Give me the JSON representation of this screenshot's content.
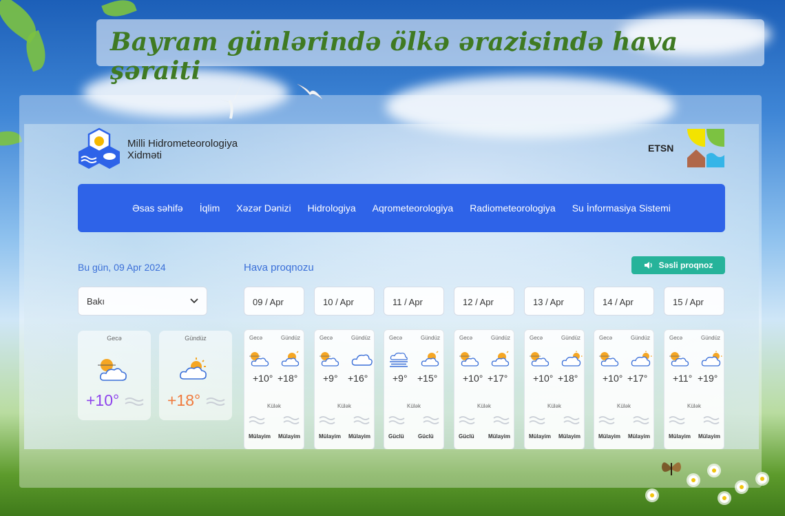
{
  "poster": {
    "title": "Bayram günlərində ölkə ərazisində hava şəraiti"
  },
  "header": {
    "org_line1": "Milli Hidrometeorologiya",
    "org_line2": "Xidməti",
    "partner": "ETSN"
  },
  "nav": [
    "Əsas səhifə",
    "İqlim",
    "Xəzər Dənizi",
    "Hidrologiya",
    "Aqrometeorologiya",
    "Radiometeorologiya",
    "Su İnformasiya Sistemi"
  ],
  "today": {
    "date_label": "Bu gün, 09 Apr 2024",
    "city": "Bakı",
    "night_label": "Gecə",
    "day_label": "Gündüz",
    "night_temp": "+10°",
    "day_temp": "+18°",
    "night_color": "#8e44ec",
    "day_color": "#f07a3c"
  },
  "forecast": {
    "label": "Hava proqnozu",
    "voice_button": "Səsli proqnoz",
    "night_label": "Gecə",
    "day_label": "Gündüz",
    "wind_label": "Külək",
    "days": [
      {
        "date": "09 / Apr",
        "night_icon": "moon-cloud-icon",
        "day_icon": "sun-cloud-icon",
        "night": "+10°",
        "day": "+18°",
        "wind_night": "Mülayim",
        "wind_day": "Mülayim"
      },
      {
        "date": "10 / Apr",
        "night_icon": "moon-cloud-icon",
        "day_icon": "cloud-icon",
        "night": "+9°",
        "day": "+16°",
        "wind_night": "Mülayim",
        "wind_day": "Mülayim"
      },
      {
        "date": "11 / Apr",
        "night_icon": "fog-icon",
        "day_icon": "sun-cloud-icon",
        "night": "+9°",
        "day": "+15°",
        "wind_night": "Güclü",
        "wind_day": "Güclü"
      },
      {
        "date": "12 / Apr",
        "night_icon": "moon-cloud-icon",
        "day_icon": "sun-cloud-icon",
        "night": "+10°",
        "day": "+17°",
        "wind_night": "Güclü",
        "wind_day": "Mülayim"
      },
      {
        "date": "13 / Apr",
        "night_icon": "moon-cloud-icon",
        "day_icon": "cloud-sun-icon",
        "night": "+10°",
        "day": "+18°",
        "wind_night": "Mülayim",
        "wind_day": "Mülayim"
      },
      {
        "date": "14 / Apr",
        "night_icon": "moon-cloud-icon",
        "day_icon": "cloud-sun-icon",
        "night": "+10°",
        "day": "+17°",
        "wind_night": "Mülayim",
        "wind_day": "Mülayim"
      },
      {
        "date": "15 / Apr",
        "night_icon": "moon-cloud-icon",
        "day_icon": "cloud-sun-icon",
        "night": "+11°",
        "day": "+19°",
        "wind_night": "Mülayim",
        "wind_day": "Mülayim"
      }
    ]
  },
  "colors": {
    "nav": "#2e63e8",
    "accent_text": "#3a6fd8",
    "voice_button": "#26b39a",
    "title": "#3f7a22"
  }
}
